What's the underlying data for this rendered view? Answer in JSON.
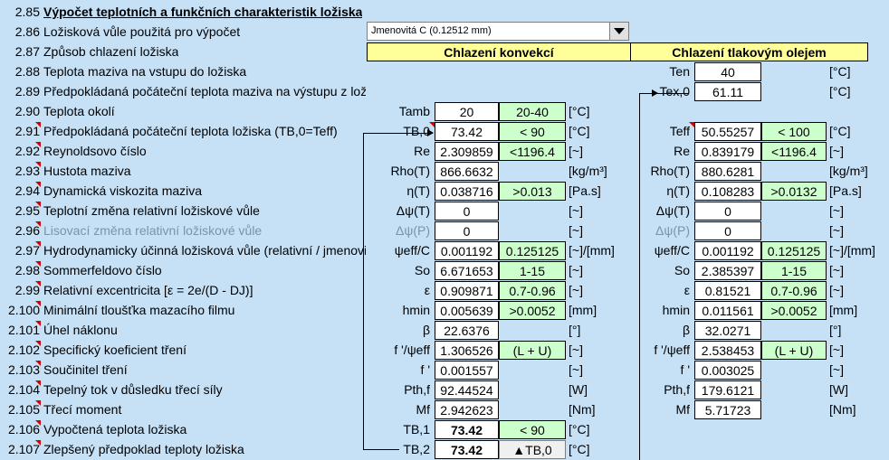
{
  "header": {
    "num": "2.85",
    "title": "Výpočet teplotních a funkčních charakteristik ložiska"
  },
  "clearance_row": {
    "num": "2.86",
    "label": "Ložisková vůle použitá pro výpočet",
    "selected": "Jmenovitá C (0.12512 mm)"
  },
  "cooling_row": {
    "num": "2.87",
    "label": "Způsob chlazení ložiska",
    "convection_header": "Chlazení konvekcí",
    "pressure_header": "Chlazení tlakovým olejem"
  },
  "rows": [
    {
      "num": "2.88",
      "label": "Teplota maziva na vstupu do ložiska",
      "style": "normal",
      "sym2": "Ten",
      "val2": "40",
      "unit2": "[°C]"
    },
    {
      "num": "2.89",
      "label": "Předpokládaná počáteční teplota maziva na výstupu z ložiska",
      "style": "normal",
      "sym2": "Tex,0",
      "val2": "61.11",
      "unit2": "[°C]"
    },
    {
      "num": "2.90",
      "label": "Teplota okolí",
      "style": "normal",
      "sym1": "Tamb",
      "val1": "20",
      "lim1": "20-40",
      "unit1": "[°C]"
    },
    {
      "num": "2.91",
      "label": "Předpokládaná počáteční teplota ložiska (TB,0=Teff)",
      "style": "normal",
      "sym1": "TB,0",
      "val1": "73.42",
      "lim1": "< 90",
      "unit1": "[°C]",
      "sym2": "Teff",
      "val2": "50.55257",
      "lim2": "< 100",
      "unit2": "[°C]"
    },
    {
      "num": "2.92",
      "label": "Reynoldsovo číslo",
      "style": "normal",
      "sym1": "Re",
      "val1": "2.309859",
      "lim1": "<1196.4",
      "unit1": "[~]",
      "sym2": "Re",
      "val2": "0.839179",
      "lim2": "<1196.4",
      "unit2": "[~]"
    },
    {
      "num": "2.93",
      "label": "Hustota maziva",
      "style": "normal",
      "sym1": "Rho(T)",
      "val1": "866.6632",
      "unit1": "[kg/m³]",
      "sym2": "Rho(T)",
      "val2": "880.6281",
      "unit2": "[kg/m³]"
    },
    {
      "num": "2.94",
      "label": "Dynamická viskozita maziva",
      "style": "normal",
      "sym1": "η(T)",
      "val1": "0.038716",
      "lim1": ">0.013",
      "unit1": "[Pa.s]",
      "sym2": "η(T)",
      "val2": "0.108283",
      "lim2": ">0.0132",
      "unit2": "[Pa.s]"
    },
    {
      "num": "2.95",
      "label": "Teplotní změna relativní ložiskové vůle",
      "style": "normal",
      "sym1": "Δψ(T)",
      "val1": "0",
      "unit1": "[~]",
      "sym2": "Δψ(T)",
      "val2": "0",
      "unit2": "[~]"
    },
    {
      "num": "2.96",
      "label": "Lisovací změna relativní ložiskové vůle",
      "style": "gray",
      "sym1": "Δψ(P)",
      "val1": "0",
      "unit1": "[~]",
      "sym2": "Δψ(P)",
      "val2": "0",
      "unit2": "[~]"
    },
    {
      "num": "2.97",
      "label": "Hydrodynamicky účinná ložisková vůle (relativní / jmenovit",
      "style": "normal",
      "sym1": "ψeff/C",
      "val1": "0.001192",
      "lim1": "0.125125",
      "unit1": "[~]/[mm]",
      "sym2": "ψeff/C",
      "val2": "0.001192",
      "lim2": "0.125125",
      "unit2": "[~]/[mm]"
    },
    {
      "num": "2.98",
      "label": "Sommerfeldovo číslo",
      "style": "normal",
      "sym1": "So",
      "val1": "6.671653",
      "lim1": "1-15",
      "unit1": "[~]",
      "sym2": "So",
      "val2": "2.385397",
      "lim2": "1-15",
      "unit2": "[~]"
    },
    {
      "num": "2.99",
      "label": "Relativní excentricita [ε = 2e/(D - DJ)]",
      "style": "normal",
      "sym1": "ε",
      "val1": "0.909871",
      "lim1": "0.7-0.96",
      "unit1": "[~]",
      "sym2": "ε",
      "val2": "0.81521",
      "lim2": "0.7-0.96",
      "unit2": "[~]"
    },
    {
      "num": "2.100",
      "label": "Minimální tloušťka mazacího filmu",
      "style": "normal",
      "sym1": "hmin",
      "val1": "0.005639",
      "lim1": ">0.0052",
      "unit1": "[mm]",
      "sym2": "hmin",
      "val2": "0.011561",
      "lim2": ">0.0052",
      "unit2": "[mm]"
    },
    {
      "num": "2.101",
      "label": "Úhel náklonu",
      "style": "normal",
      "sym1": "β",
      "val1": "22.6376",
      "unit1": "[°]",
      "sym2": "β",
      "val2": "32.0271",
      "unit2": "[°]"
    },
    {
      "num": "2.102",
      "label": "Specifický koeficient tření",
      "style": "normal",
      "sym1": "f '/ψeff",
      "val1": "1.306526",
      "lim1": "(L + U)",
      "unit1": "[~]",
      "sym2": "f '/ψeff",
      "val2": "2.538453",
      "lim2": "(L + U)",
      "unit2": "[~]"
    },
    {
      "num": "2.103",
      "label": "Součinitel tření",
      "style": "normal",
      "sym1": "f '",
      "val1": "0.001557",
      "unit1": "[~]",
      "sym2": "f '",
      "val2": "0.003025",
      "unit2": "[~]"
    },
    {
      "num": "2.104",
      "label": "Tepelný tok v důsledku třecí síly",
      "style": "normal",
      "sym1": "Pth,f",
      "val1": "92.44524",
      "unit1": "[W]",
      "sym2": "Pth,f",
      "val2": "179.6121",
      "unit2": "[W]"
    },
    {
      "num": "2.105",
      "label": "Třecí moment",
      "style": "normal",
      "sym1": "Mf",
      "val1": "2.942623",
      "unit1": "[Nm]",
      "sym2": "Mf",
      "val2": "5.71723",
      "unit2": "[Nm]"
    },
    {
      "num": "2.106",
      "label": "Vypočtená teplota ložiska",
      "style": "normal",
      "sym1": "TB,1",
      "val1": "73.42",
      "val1_bold": true,
      "lim1": "< 90",
      "unit1": "[°C]"
    },
    {
      "num": "2.107",
      "label": "Zlepšený předpoklad teploty ložiska",
      "style": "normal",
      "sym1": "TB,2",
      "val1": "73.42",
      "val1_bold": true,
      "btn1": "▲TB,0",
      "unit1": "[°C]"
    }
  ],
  "colors": {
    "background": "#c6e0f5",
    "limit_green": "#ccffcc",
    "header_yellow": "#ffff99",
    "marker_red": "#d40000"
  },
  "icons": {
    "dropdown": "chevron-down-icon",
    "comment_marker": "comment-marker-icon"
  }
}
